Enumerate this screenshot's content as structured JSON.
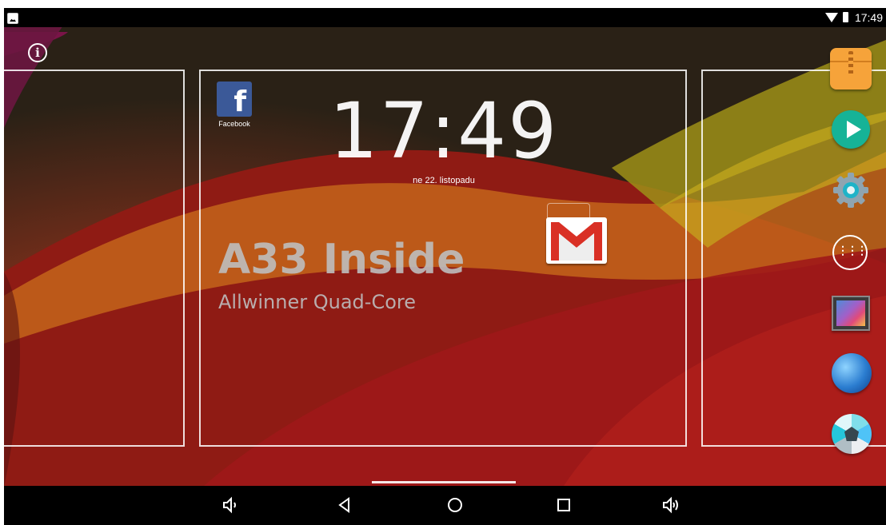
{
  "status_bar": {
    "time": "17:49"
  },
  "homescreen": {
    "clock_widget": {
      "time": "17:49",
      "date": "ne 22. listopadu"
    },
    "brand": {
      "title": "A33 Inside",
      "subtitle": "Allwinner Quad-Core"
    },
    "shortcuts": [
      {
        "label": "Facebook",
        "icon": "facebook-icon"
      },
      {
        "label": "",
        "icon": "gmail-icon"
      }
    ],
    "dock": [
      "archive-app-icon",
      "play-store-icon",
      "settings-icon",
      "app-drawer-icon",
      "gallery-icon",
      "browser-icon",
      "camera-icon"
    ]
  },
  "nav_bar": {
    "buttons": [
      "volume-down-icon",
      "back-icon",
      "home-icon",
      "recents-icon",
      "volume-up-icon"
    ]
  },
  "colors": {
    "facebook": "#3b5998",
    "gmail_red": "#d93025",
    "play_green": "#16b397",
    "archive_orange": "#f6a33a"
  }
}
